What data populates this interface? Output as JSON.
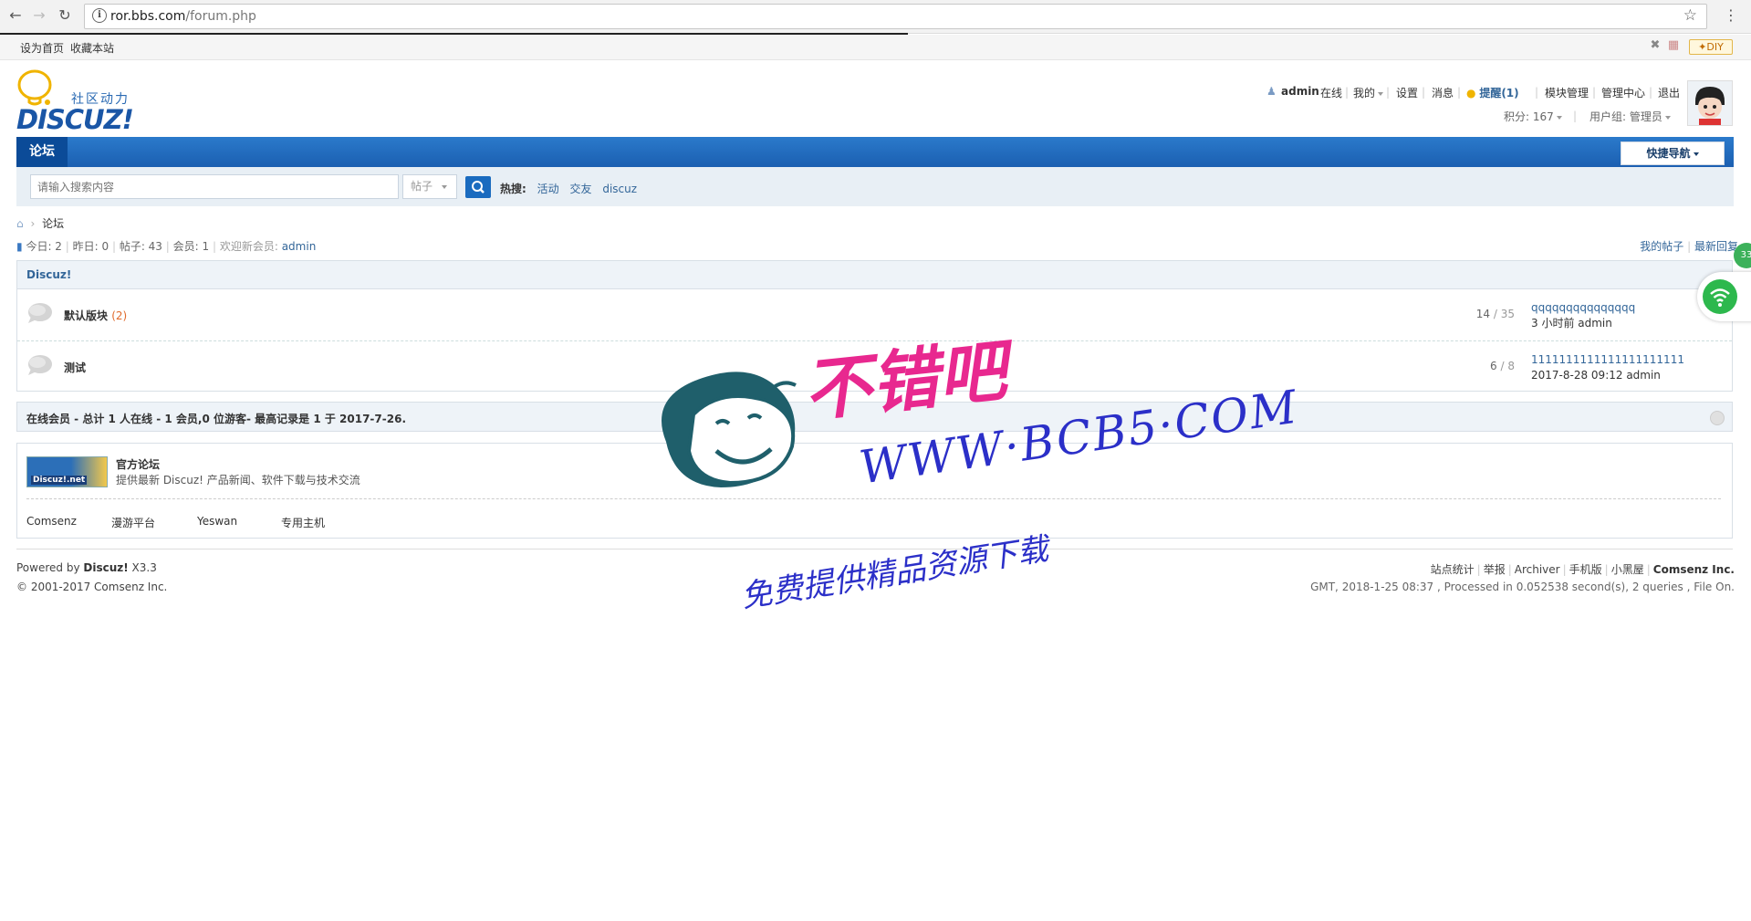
{
  "browser": {
    "url_host": "ror.bbs.com",
    "url_path": "/forum.php"
  },
  "topbar": {
    "set_home": "设为首页",
    "bookmark": "收藏本站",
    "diy": "DIY"
  },
  "header": {
    "logo_sub": "社区动力",
    "logo_main": "DISCUZ!",
    "username": "admin",
    "online": "在线",
    "my": "我的",
    "settings": "设置",
    "messages": "消息",
    "remind": "提醒(1)",
    "module_manage": "模块管理",
    "admin_center": "管理中心",
    "logout": "退出",
    "credits": "积分: 167",
    "usergroup": "用户组: 管理员"
  },
  "nav": {
    "tab_forum": "论坛",
    "quick_nav": "快捷导航"
  },
  "search": {
    "placeholder": "请输入搜索内容",
    "type": "帖子",
    "hot_label": "热搜:",
    "hot": [
      "活动",
      "交友",
      "discuz"
    ]
  },
  "breadcrumb": {
    "current": "论坛"
  },
  "stats": {
    "today": "今日: 2",
    "yesterday": "昨日: 0",
    "posts": "帖子: 43",
    "members": "会员: 1",
    "welcome_label": "欢迎新会员:",
    "welcome_user": "admin",
    "my_posts": "我的帖子",
    "latest_reply": "最新回复"
  },
  "category": {
    "title": "Discuz!",
    "forums": [
      {
        "name": "默认版块",
        "count": "(2)",
        "threads": "14",
        "posts": "35",
        "last_title": "qqqqqqqqqqqqqqq",
        "last_meta": "3 小时前 admin"
      },
      {
        "name": "测试",
        "count": "",
        "threads": "6",
        "posts": "8",
        "last_title": "1111111111111111111111",
        "last_meta": "2017-8-28 09:12 admin"
      }
    ]
  },
  "online": {
    "text": "在线会员 - 总计 1 人在线 - 1 会员,0 位游客- 最高记录是 1 于 2017-7-26."
  },
  "links": {
    "logo_text": "Discuz!.net",
    "official_title": "官方论坛",
    "official_desc": "提供最新 Discuz! 产品新闻、软件下载与技术交流",
    "items": [
      "Comsenz",
      "漫游平台",
      "Yeswan",
      "专用主机"
    ]
  },
  "footer": {
    "powered_prefix": "Powered by ",
    "powered_name": "Discuz!",
    "powered_ver": " X3.3",
    "copyright": "© 2001-2017 Comsenz Inc.",
    "right_links": [
      "站点统计",
      "举报",
      "Archiver",
      "手机版",
      "小黑屋"
    ],
    "company": "Comsenz Inc.",
    "processed": "GMT, 2018-1-25 08:37 , Processed in 0.052538 second(s), 2 queries , File On."
  },
  "side": {
    "badge": "33"
  },
  "watermark": {
    "line1": "不错吧",
    "line2": "WWW·BCB5·COM",
    "line3": "免费提供精品资源下载"
  },
  "colors": {
    "nav_blue": "#1b5fb1",
    "link_blue": "#336699",
    "count_orange": "#e06a2c",
    "watermark_pink": "#e8288f",
    "watermark_blue": "#2b2fc8"
  }
}
